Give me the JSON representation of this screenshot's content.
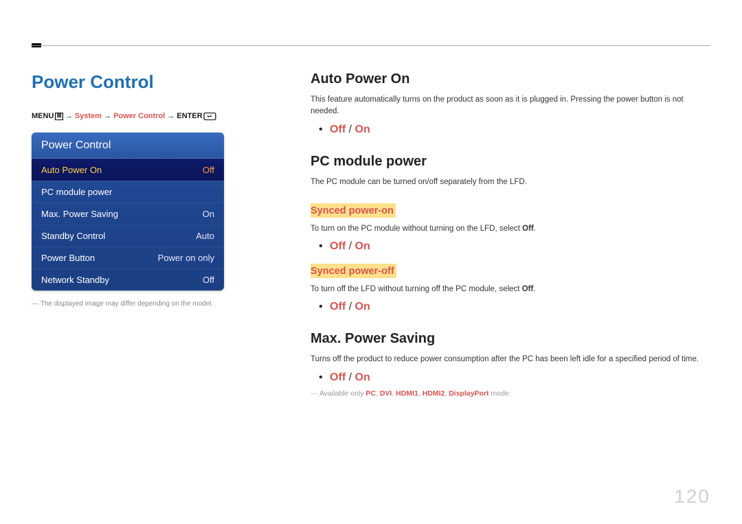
{
  "page_number": "120",
  "left": {
    "title": "Power Control",
    "breadcrumb": {
      "menu": "MENU",
      "arrow": "→",
      "system": "System",
      "power_control": "Power Control",
      "enter": "ENTER"
    },
    "osd": {
      "header": "Power Control",
      "rows": [
        {
          "label": "Auto Power On",
          "value": "Off",
          "selected": true
        },
        {
          "label": "PC module power",
          "value": "",
          "selected": false
        },
        {
          "label": "Max. Power Saving",
          "value": "On",
          "selected": false
        },
        {
          "label": "Standby Control",
          "value": "Auto",
          "selected": false
        },
        {
          "label": "Power Button",
          "value": "Power on only",
          "selected": false
        },
        {
          "label": "Network Standby",
          "value": "Off",
          "selected": false
        }
      ]
    },
    "footnote": "The displayed image may differ depending on the model."
  },
  "right": {
    "auto_power_on": {
      "heading": "Auto Power On",
      "desc": "This feature automatically turns on the product as soon as it is plugged in. Pressing the power button is not needed.",
      "off": "Off",
      "slash": "/",
      "on": "On"
    },
    "pc_module": {
      "heading": "PC module power",
      "desc": "The PC module can be turned on/off separately from the LFD.",
      "synced_on": {
        "heading": "Synced power-on",
        "desc_pre": "To turn on the PC module without turning on the LFD, select ",
        "desc_bold": "Off",
        "desc_post": ".",
        "off": "Off",
        "slash": "/",
        "on": "On"
      },
      "synced_off": {
        "heading": "Synced power-off",
        "desc_pre": "To turn off the LFD without turning off the PC module, select ",
        "desc_bold": "Off",
        "desc_post": ".",
        "off": "Off",
        "slash": "/",
        "on": "On"
      }
    },
    "max_saving": {
      "heading": "Max. Power Saving",
      "desc": "Turns off the product to reduce power consumption after the PC has been left idle for a specified period of time.",
      "off": "Off",
      "slash": "/",
      "on": "On",
      "avail_pre": "Available only ",
      "modes": [
        "PC",
        "DVI",
        "HDMI1",
        "HDMI2",
        "DisplayPort"
      ],
      "avail_post": " mode."
    }
  }
}
